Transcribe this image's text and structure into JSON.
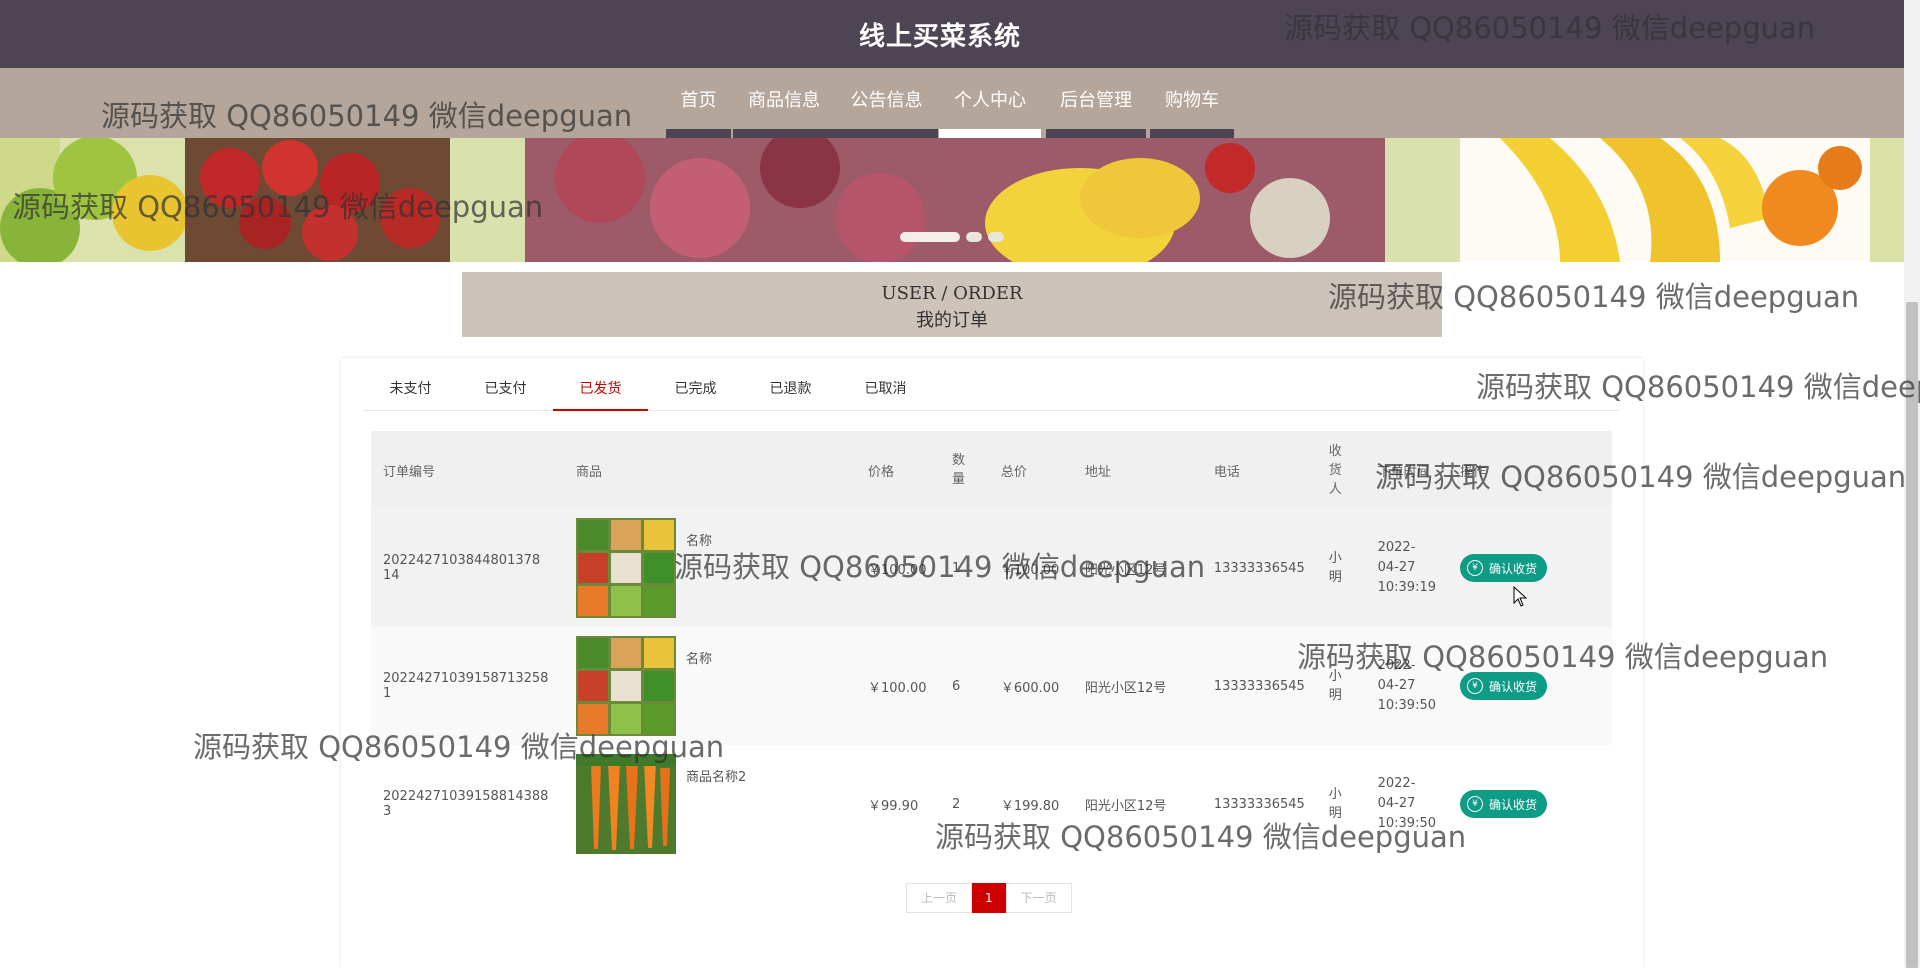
{
  "header": {
    "site_title": "线上买菜系统"
  },
  "nav": {
    "items": [
      {
        "label": "首页"
      },
      {
        "label": "商品信息"
      },
      {
        "label": "公告信息"
      },
      {
        "label": "个人中心"
      },
      {
        "label": "后台管理"
      },
      {
        "label": "购物车"
      }
    ],
    "active": "个人中心"
  },
  "banner": {
    "slides": 3,
    "active_slide": 1
  },
  "page_heading": {
    "en": "USER / ORDER",
    "cn": "我的订单"
  },
  "tabs": {
    "items": [
      {
        "label": "未支付"
      },
      {
        "label": "已支付"
      },
      {
        "label": "已发货"
      },
      {
        "label": "已完成"
      },
      {
        "label": "已退款"
      },
      {
        "label": "已取消"
      }
    ],
    "active": "已发货"
  },
  "table": {
    "headers": {
      "order_no": "订单编号",
      "goods": "商品",
      "price": "价格",
      "qty": "数量",
      "total": "总价",
      "address": "地址",
      "phone": "电话",
      "receiver": "收货人",
      "time": "下单时间",
      "action": "操作"
    },
    "rows": [
      {
        "order_no": "2022427103844801378 14",
        "goods_name": "名称",
        "price": "￥100.00",
        "qty": "1",
        "total": "￥100.00",
        "address": "阳光小区12号",
        "phone": "13333336545",
        "receiver": "小明",
        "time": "2022-04-27 10:39:19",
        "action": "确认收货"
      },
      {
        "order_no": "20224271039158713258 1",
        "goods_name": "名称",
        "price": "￥100.00",
        "qty": "6",
        "total": "￥600.00",
        "address": "阳光小区12号",
        "phone": "13333336545",
        "receiver": "小明",
        "time": "2022-04-27 10:39:50",
        "action": "确认收货"
      },
      {
        "order_no": "20224271039158814388 3",
        "goods_name": "商品名称2",
        "price": "￥99.90",
        "qty": "2",
        "total": "￥199.80",
        "address": "阳光小区12号",
        "phone": "13333336545",
        "receiver": "小明",
        "time": "2022-04-27 10:39:50",
        "action": "确认收货"
      }
    ]
  },
  "pagination": {
    "prev": "上一页",
    "current": "1",
    "next": "下一页"
  },
  "watermark": "源码获取 QQ86050149 微信deepguan"
}
